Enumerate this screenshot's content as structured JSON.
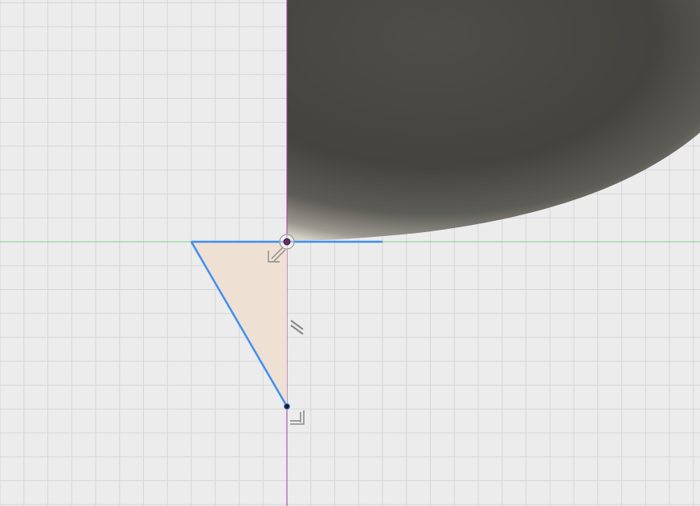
{
  "colors": {
    "canvas_background": "#ececec",
    "grid_line": "#d6d6d6",
    "x_axis": "#7fd27f",
    "y_axis": "#a43aa4",
    "sketch_line": "#3f8ff0",
    "profile_fill": "#eee0d3",
    "solid_body_dark": "#45433e",
    "solid_body_light": "#5a5852",
    "constraint_glyph": "#8a8a8a",
    "origin_point": "#6b2a6b"
  },
  "icons": {
    "origin": "origin-point-icon",
    "coincident": "coincident-constraint-icon",
    "parallel": "parallel-constraint-icon",
    "perpendicular": "perpendicular-constraint-icon",
    "endpoint": "sketch-endpoint-icon"
  }
}
